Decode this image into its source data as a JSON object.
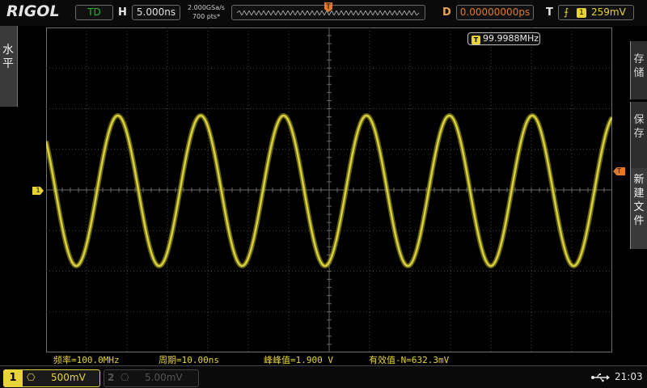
{
  "brand": {
    "logo": "RIGOL"
  },
  "top": {
    "run_status": "TD",
    "h_label": "H",
    "timebase": "5.000ns",
    "sample_rate": "2.000GSa/s",
    "mem_depth": "700 pts*",
    "trig_pos_marker": "T",
    "d_label": "D",
    "delay": "0.00000000ps",
    "t_label": "T",
    "trigger_edge_icon": "rising-edge-icon",
    "trigger_source": "1",
    "trigger_level": "259mV"
  },
  "grid": {
    "freq_badge_t": "T",
    "freq_readout": "99.9988MHz",
    "trace_color": "#d8cf3c",
    "grid_color": "#4a4a4a"
  },
  "side_left": {
    "label": "水平"
  },
  "side_right": {
    "items": [
      "存储",
      "保存",
      "新建文件"
    ]
  },
  "markers": {
    "ch1": "1",
    "trigger": "T"
  },
  "measurements": [
    "频率=100.0MHz",
    "周期=10.00ns",
    "峰峰值=1.900 V",
    "有效值-N=632.3mV"
  ],
  "bottom": {
    "ch1": {
      "num": "1",
      "coupling": "⎔",
      "scale": "500mV"
    },
    "ch2": {
      "num": "2",
      "coupling": "⎔",
      "scale": "5.00mV"
    },
    "usb_icon": "usb-icon",
    "time": "21:03"
  },
  "colors": {
    "ch1": "#e6d33a",
    "accent": "#e07a2a",
    "run": "#2fb12f"
  }
}
